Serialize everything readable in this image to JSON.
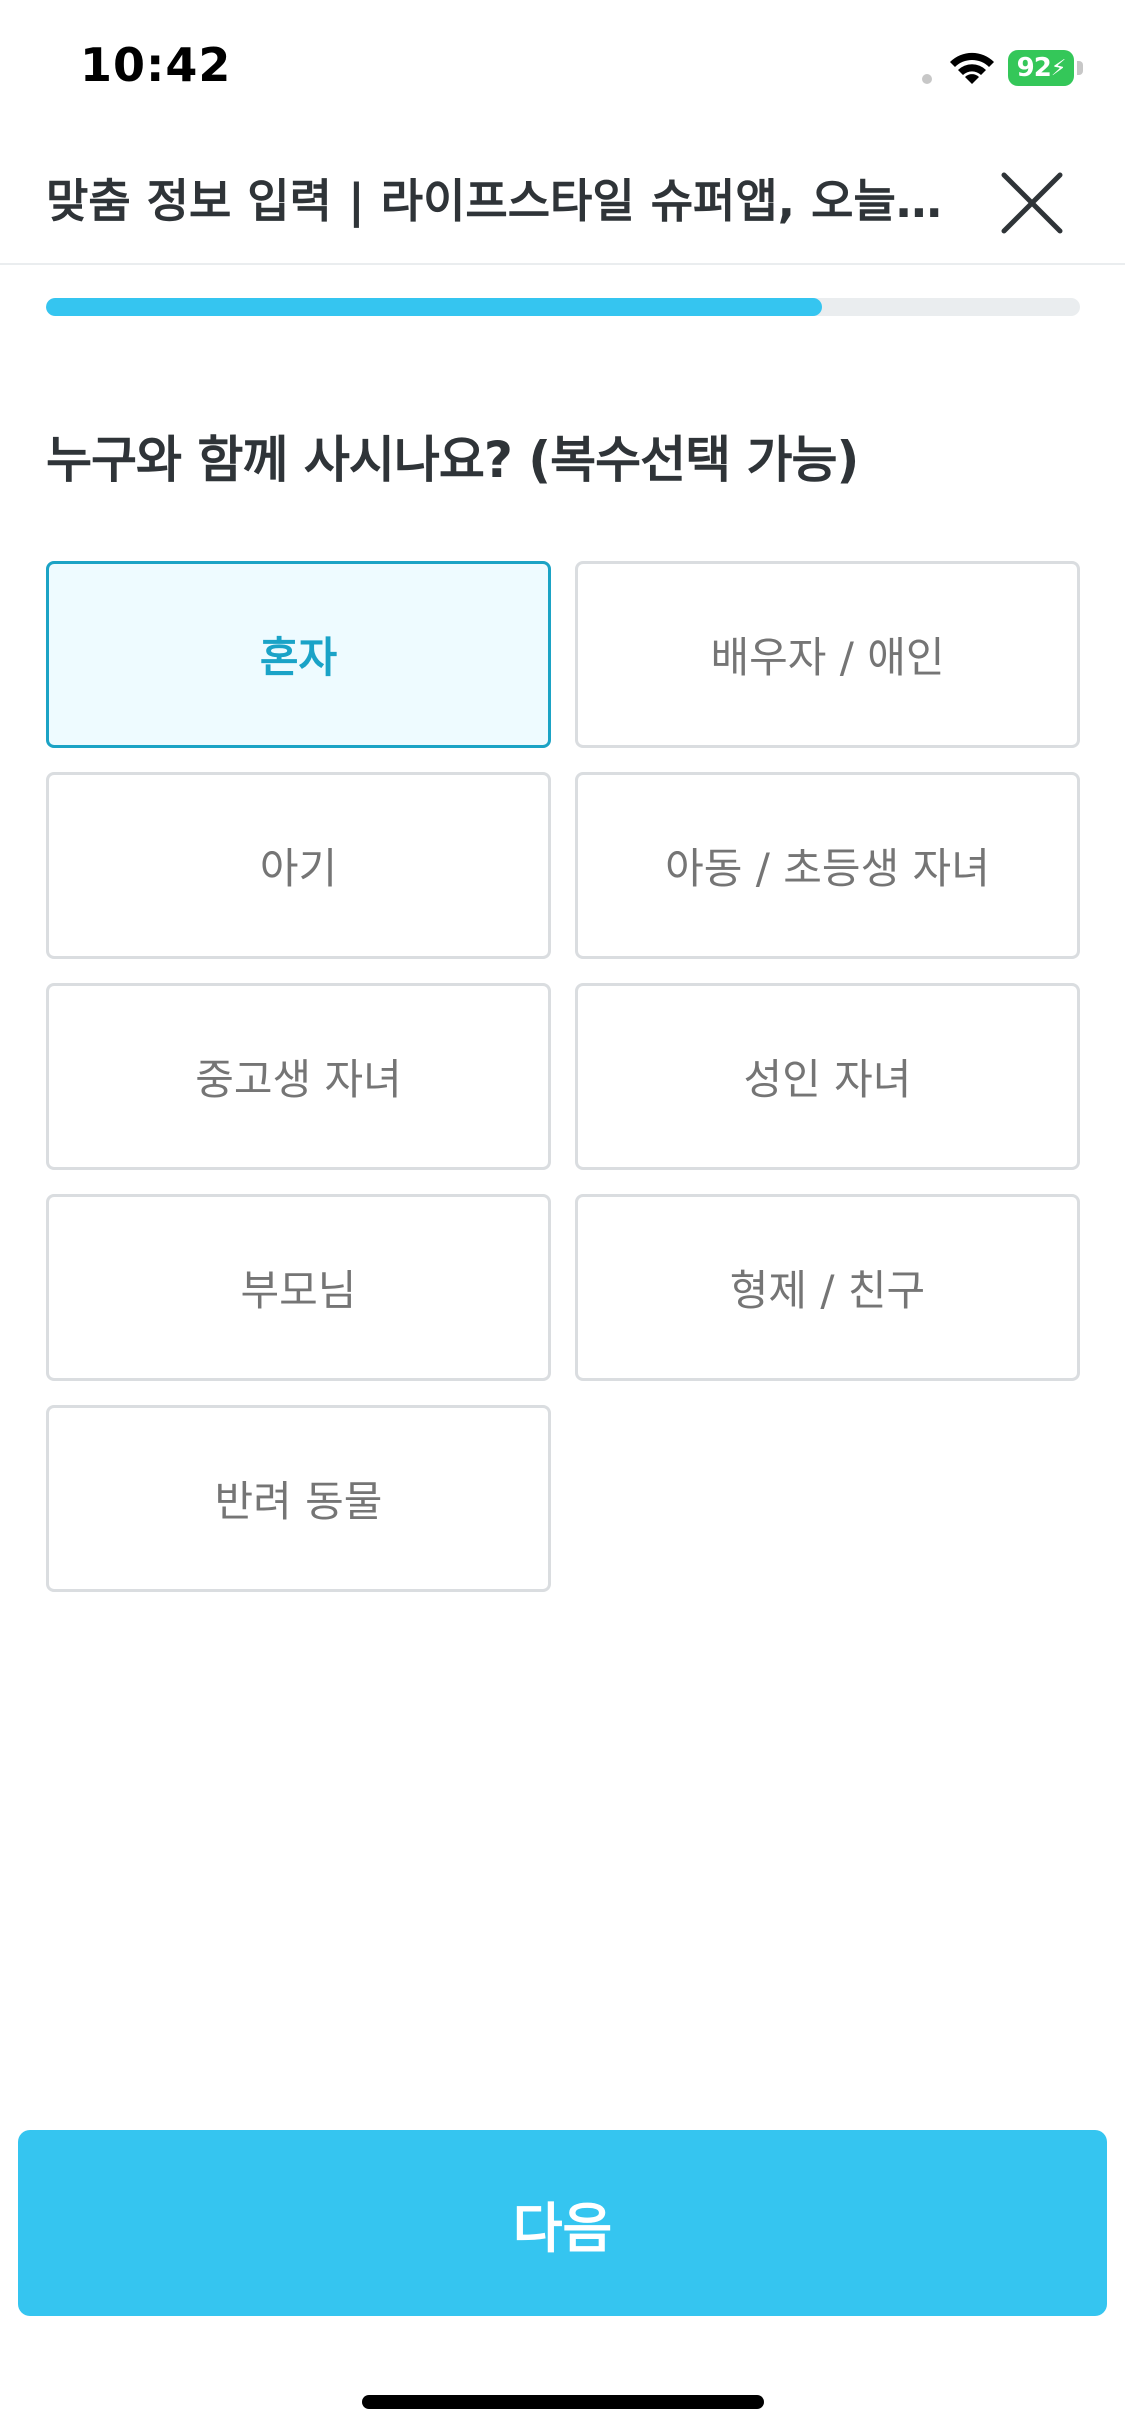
{
  "status_bar": {
    "time": "10:42",
    "battery_level": "92",
    "icons": [
      "wifi-icon",
      "battery-charging-icon"
    ]
  },
  "header": {
    "title": "맞춤 정보 입력 | 라이프스타일 슈퍼앱, 오늘의집",
    "close_icon": "close-icon"
  },
  "progress": {
    "fraction": 0.75
  },
  "question": "누구와 함께 사시나요? (복수선택 가능)",
  "options": [
    {
      "label": "혼자",
      "selected": true
    },
    {
      "label": "배우자 / 애인",
      "selected": false
    },
    {
      "label": "아기",
      "selected": false
    },
    {
      "label": "아동 / 초등생 자녀",
      "selected": false
    },
    {
      "label": "중고생 자녀",
      "selected": false
    },
    {
      "label": "성인 자녀",
      "selected": false
    },
    {
      "label": "부모님",
      "selected": false
    },
    {
      "label": "형제 / 친구",
      "selected": false
    },
    {
      "label": "반려 동물",
      "selected": false
    }
  ],
  "next_button": {
    "label": "다음"
  },
  "colors": {
    "accent": "#35c5f0",
    "selected_border": "#1ba3c5",
    "selected_bg": "#eefbff",
    "selected_text": "#1aa3c7",
    "battery": "#34c759"
  }
}
